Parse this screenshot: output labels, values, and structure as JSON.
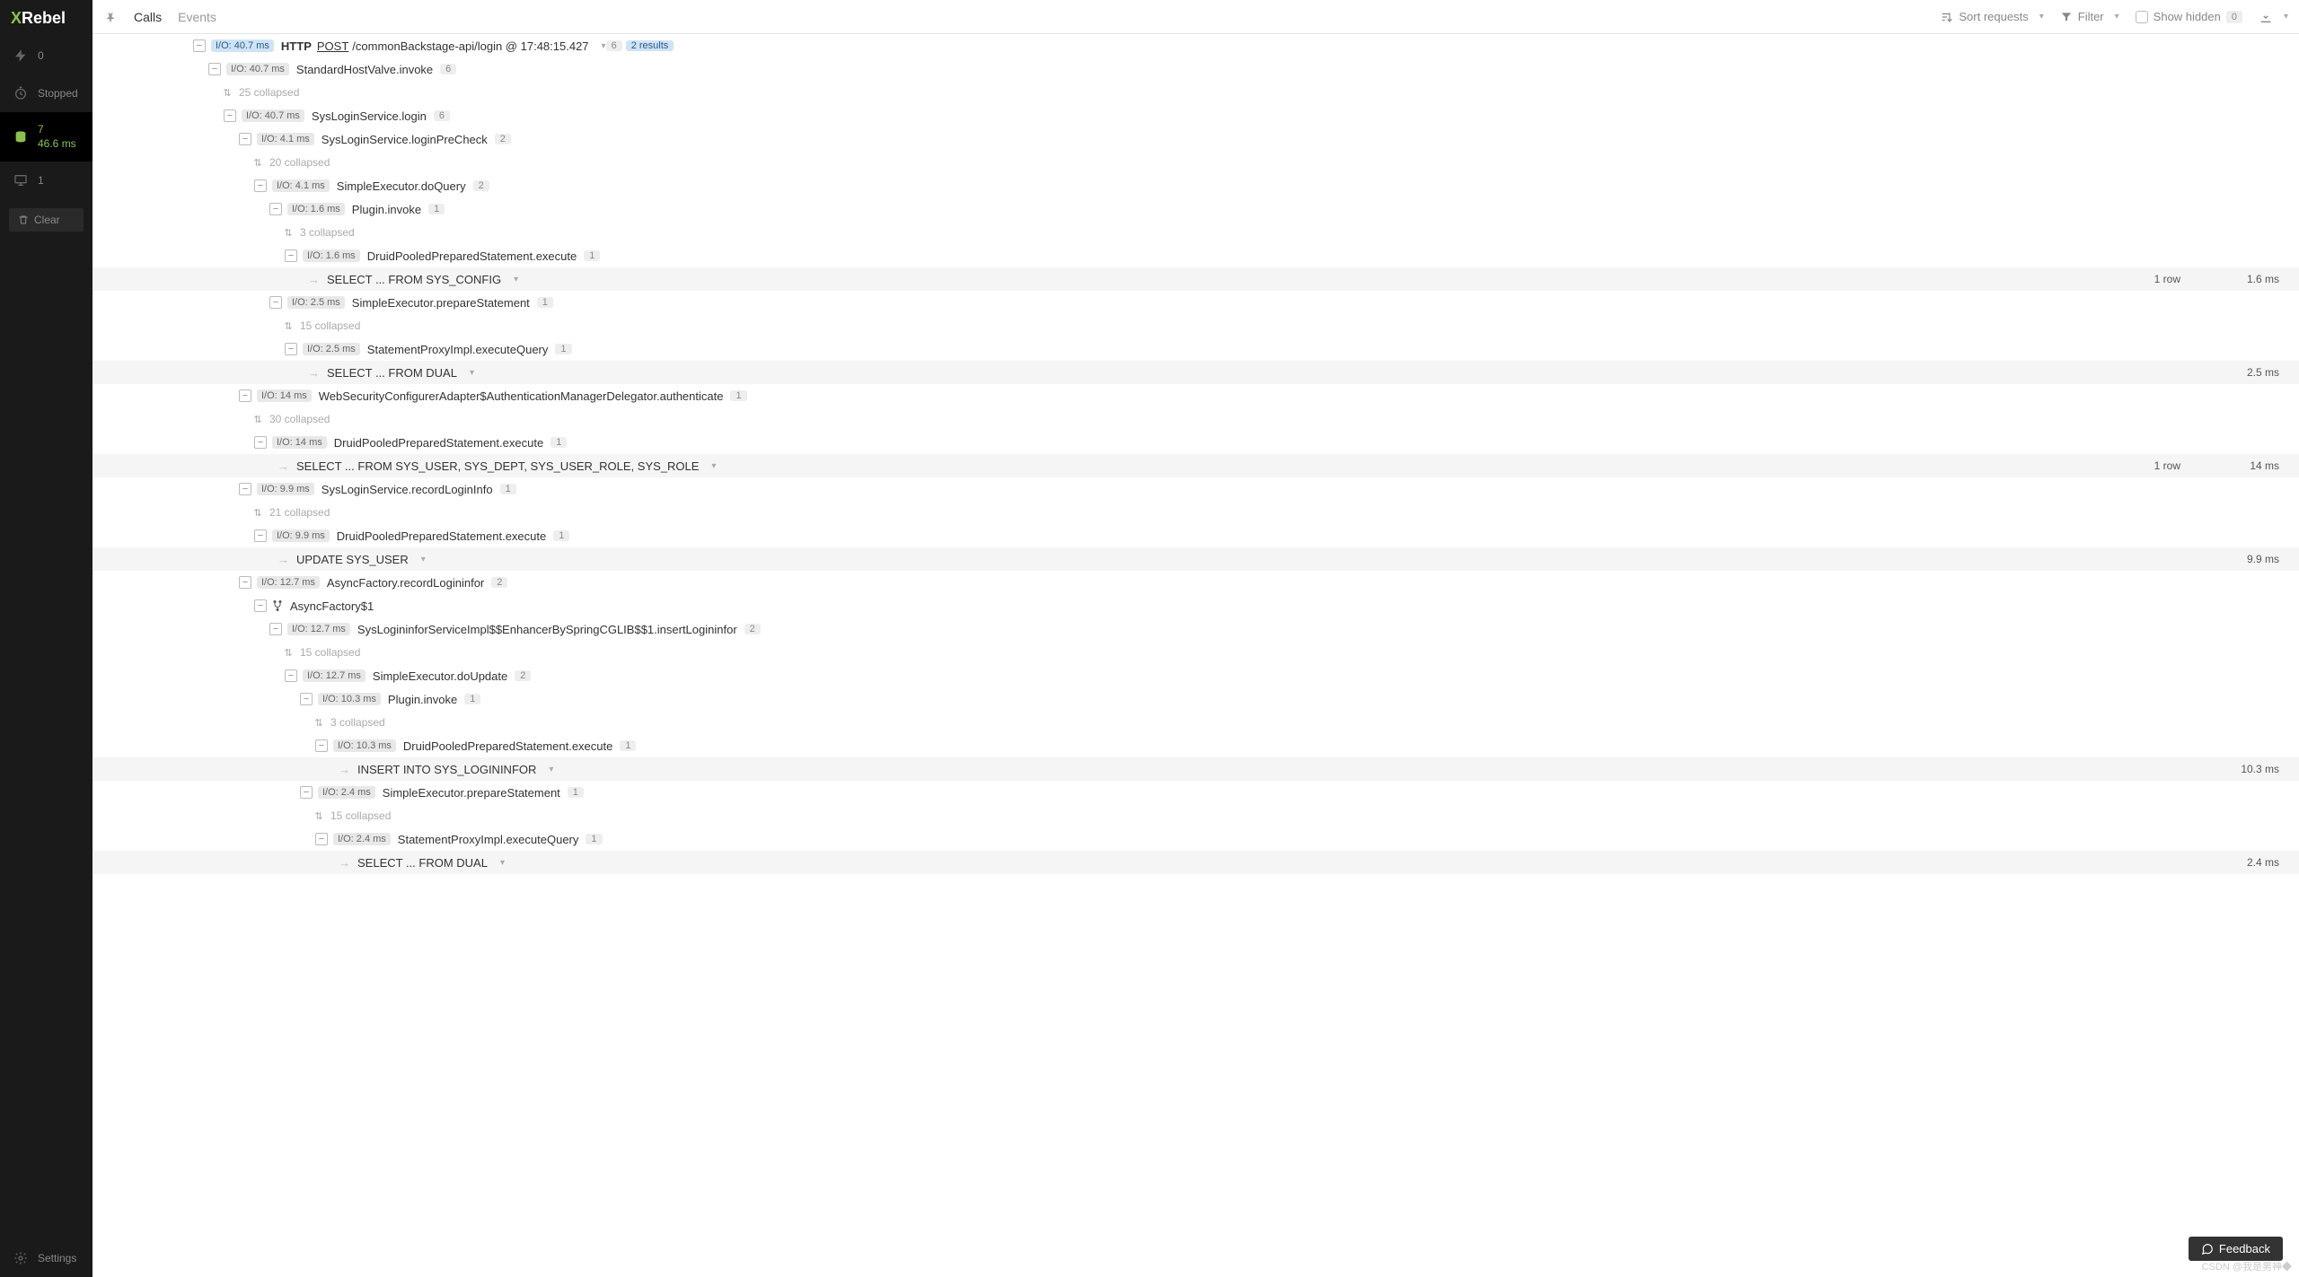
{
  "logo": {
    "x": "X",
    "rest": "Rebel"
  },
  "sidebar": {
    "flash": "0",
    "stopped": "Stopped",
    "db_count": "7",
    "db_time": "46.6 ms",
    "monitor": "1",
    "clear": "Clear",
    "settings": "Settings"
  },
  "topbar": {
    "tab_calls": "Calls",
    "tab_events": "Events",
    "sort": "Sort requests",
    "filter": "Filter",
    "show_hidden": "Show hidden",
    "hidden_count": "0"
  },
  "tree": [
    {
      "depth": 0,
      "type": "node",
      "io": "I/O: 40.7 ms",
      "rootIo": true,
      "http": "HTTP",
      "method": "POST",
      "path": "/commonBackstage-api/login",
      "ts": "@ 17:48:15.427",
      "count": "6",
      "results": "2 results"
    },
    {
      "depth": 1,
      "type": "node",
      "io": "I/O: 40.7 ms",
      "name": "StandardHostValve.invoke",
      "count": "6"
    },
    {
      "depth": 1,
      "type": "collapsed",
      "text": "25 collapsed"
    },
    {
      "depth": 2,
      "type": "node",
      "io": "I/O: 40.7 ms",
      "name": "SysLoginService.login",
      "count": "6"
    },
    {
      "depth": 3,
      "type": "node",
      "io": "I/O: 4.1 ms",
      "name": "SysLoginService.loginPreCheck",
      "count": "2"
    },
    {
      "depth": 3,
      "type": "collapsed",
      "text": "20 collapsed"
    },
    {
      "depth": 4,
      "type": "node",
      "io": "I/O: 4.1 ms",
      "name": "SimpleExecutor.doQuery",
      "count": "2"
    },
    {
      "depth": 5,
      "type": "node",
      "io": "I/O: 1.6 ms",
      "name": "Plugin.invoke",
      "count": "1"
    },
    {
      "depth": 5,
      "type": "collapsed",
      "text": "3 collapsed"
    },
    {
      "depth": 6,
      "type": "node",
      "io": "I/O: 1.6 ms",
      "name": "DruidPooledPreparedStatement.execute",
      "count": "1"
    },
    {
      "depth": 6,
      "type": "sql",
      "text": "SELECT ... FROM SYS_CONFIG",
      "rows": "1 row",
      "time": "1.6 ms"
    },
    {
      "depth": 5,
      "type": "node",
      "io": "I/O: 2.5 ms",
      "name": "SimpleExecutor.prepareStatement",
      "count": "1"
    },
    {
      "depth": 5,
      "type": "collapsed",
      "text": "15 collapsed"
    },
    {
      "depth": 6,
      "type": "node",
      "io": "I/O: 2.5 ms",
      "name": "StatementProxyImpl.executeQuery",
      "count": "1"
    },
    {
      "depth": 6,
      "type": "sql",
      "text": "SELECT ... FROM DUAL",
      "rows": "",
      "time": "2.5 ms"
    },
    {
      "depth": 3,
      "type": "node",
      "io": "I/O: 14 ms",
      "name": "WebSecurityConfigurerAdapter$AuthenticationManagerDelegator.authenticate",
      "count": "1"
    },
    {
      "depth": 3,
      "type": "collapsed",
      "text": "30 collapsed"
    },
    {
      "depth": 4,
      "type": "node",
      "io": "I/O: 14 ms",
      "name": "DruidPooledPreparedStatement.execute",
      "count": "1"
    },
    {
      "depth": 4,
      "type": "sql",
      "text": "SELECT ... FROM SYS_USER, SYS_DEPT, SYS_USER_ROLE, SYS_ROLE",
      "rows": "1 row",
      "time": "14 ms"
    },
    {
      "depth": 3,
      "type": "node",
      "io": "I/O: 9.9 ms",
      "name": "SysLoginService.recordLoginInfo",
      "count": "1"
    },
    {
      "depth": 3,
      "type": "collapsed",
      "text": "21 collapsed"
    },
    {
      "depth": 4,
      "type": "node",
      "io": "I/O: 9.9 ms",
      "name": "DruidPooledPreparedStatement.execute",
      "count": "1"
    },
    {
      "depth": 4,
      "type": "sql",
      "text": "UPDATE SYS_USER",
      "rows": "",
      "time": "9.9 ms"
    },
    {
      "depth": 3,
      "type": "node",
      "io": "I/O: 12.7 ms",
      "name": "AsyncFactory.recordLogininfor",
      "count": "2"
    },
    {
      "depth": 4,
      "type": "fork",
      "name": "AsyncFactory$1"
    },
    {
      "depth": 5,
      "type": "node",
      "io": "I/O: 12.7 ms",
      "name": "SysLogininforServiceImpl$$EnhancerBySpringCGLIB$$1.insertLogininfor",
      "count": "2"
    },
    {
      "depth": 5,
      "type": "collapsed",
      "text": "15 collapsed"
    },
    {
      "depth": 6,
      "type": "node",
      "io": "I/O: 12.7 ms",
      "name": "SimpleExecutor.doUpdate",
      "count": "2"
    },
    {
      "depth": 7,
      "type": "node",
      "io": "I/O: 10.3 ms",
      "name": "Plugin.invoke",
      "count": "1"
    },
    {
      "depth": 7,
      "type": "collapsed",
      "text": "3 collapsed"
    },
    {
      "depth": 8,
      "type": "node",
      "io": "I/O: 10.3 ms",
      "name": "DruidPooledPreparedStatement.execute",
      "count": "1"
    },
    {
      "depth": 8,
      "type": "sql",
      "text": "INSERT INTO SYS_LOGININFOR",
      "rows": "",
      "time": "10.3 ms"
    },
    {
      "depth": 7,
      "type": "node",
      "io": "I/O: 2.4 ms",
      "name": "SimpleExecutor.prepareStatement",
      "count": "1"
    },
    {
      "depth": 7,
      "type": "collapsed",
      "text": "15 collapsed"
    },
    {
      "depth": 8,
      "type": "node",
      "io": "I/O: 2.4 ms",
      "name": "StatementProxyImpl.executeQuery",
      "count": "1"
    },
    {
      "depth": 8,
      "type": "sql",
      "text": "SELECT ... FROM DUAL",
      "rows": "",
      "time": "2.4 ms"
    }
  ],
  "feedback": "Feedback",
  "watermark": "CSDN @我是男神◆"
}
